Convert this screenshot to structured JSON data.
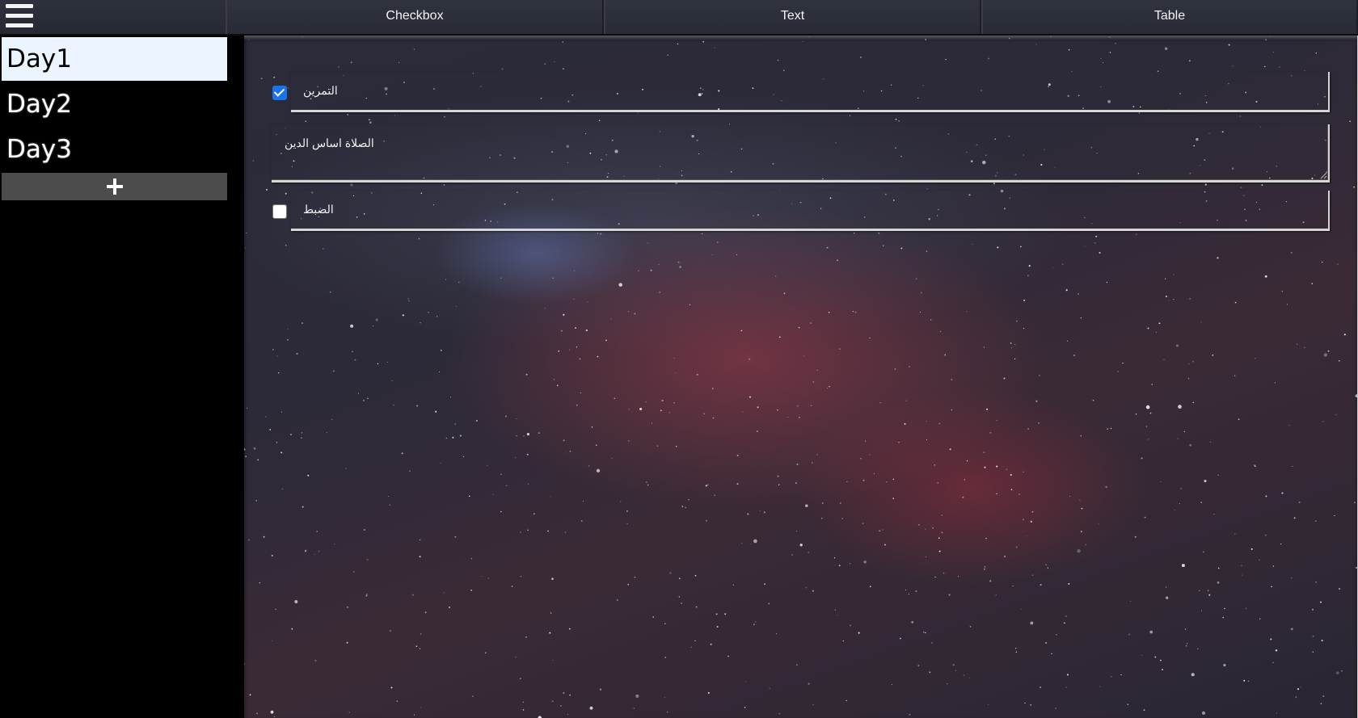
{
  "header": {
    "menu_icon": "hamburger-menu-icon",
    "tabs": [
      {
        "label": "Checkbox"
      },
      {
        "label": "Text"
      },
      {
        "label": "Table"
      }
    ]
  },
  "sidebar": {
    "days": [
      {
        "label": "Day1",
        "active": true
      },
      {
        "label": "Day2",
        "active": false
      },
      {
        "label": "Day3",
        "active": false
      }
    ],
    "add_icon": "plus-icon"
  },
  "main": {
    "items": [
      {
        "type": "checkbox",
        "checked": true,
        "label": "التمرين"
      },
      {
        "type": "text",
        "value": "الصلاة اساس الدين"
      },
      {
        "type": "checkbox",
        "checked": false,
        "label": "الضبط"
      }
    ]
  },
  "colors": {
    "active_day_bg": "#eaf5ff",
    "checkbox_accent": "#1a73e8",
    "add_button_bg": "#4c4c4c"
  }
}
